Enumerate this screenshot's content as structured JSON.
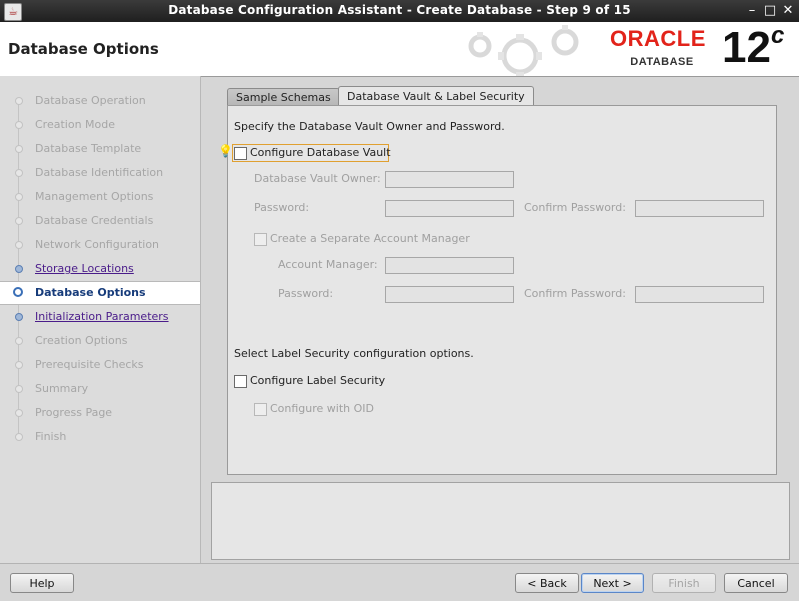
{
  "window": {
    "title": "Database Configuration Assistant - Create Database - Step 9 of 15",
    "controls": {
      "minimize": "–",
      "maximize": "□",
      "close": "✕"
    }
  },
  "header": {
    "page_title": "Database Options",
    "brand": {
      "wordmark": "ORACLE",
      "product": "DATABASE",
      "version": "12",
      "version_suffix": "c"
    }
  },
  "nav": {
    "items": [
      {
        "label": "Database Operation",
        "state": "disabled"
      },
      {
        "label": "Creation Mode",
        "state": "disabled"
      },
      {
        "label": "Database Template",
        "state": "disabled"
      },
      {
        "label": "Database Identification",
        "state": "disabled"
      },
      {
        "label": "Management Options",
        "state": "disabled"
      },
      {
        "label": "Database Credentials",
        "state": "disabled"
      },
      {
        "label": "Network Configuration",
        "state": "disabled"
      },
      {
        "label": "Storage Locations",
        "state": "link"
      },
      {
        "label": "Database Options",
        "state": "current"
      },
      {
        "label": "Initialization Parameters",
        "state": "link"
      },
      {
        "label": "Creation Options",
        "state": "disabled"
      },
      {
        "label": "Prerequisite Checks",
        "state": "disabled"
      },
      {
        "label": "Summary",
        "state": "disabled"
      },
      {
        "label": "Progress Page",
        "state": "disabled"
      },
      {
        "label": "Finish",
        "state": "disabled"
      }
    ]
  },
  "tabs": {
    "sample_schemas": "Sample Schemas",
    "vault_label_security": "Database Vault & Label Security",
    "active": "vault_label_security"
  },
  "vault": {
    "intro": "Specify the Database Vault Owner and Password.",
    "configure_label": "Configure Database Vault",
    "configure_checked": false,
    "owner_label": "Database Vault Owner:",
    "owner_value": "",
    "password_label": "Password:",
    "password_value": "",
    "confirm_password_label": "Confirm Password:",
    "confirm_password_value": "",
    "separate_account_label": "Create a Separate Account Manager",
    "separate_account_checked": false,
    "account_manager_label": "Account Manager:",
    "account_manager_value": "",
    "am_password_label": "Password:",
    "am_password_value": "",
    "am_confirm_password_label": "Confirm Password:",
    "am_confirm_password_value": ""
  },
  "label_security": {
    "intro": "Select Label Security configuration options.",
    "configure_label": "Configure Label Security",
    "configure_checked": false,
    "oid_label": "Configure with OID",
    "oid_checked": false
  },
  "buttons": {
    "help": "Help",
    "back": "< Back",
    "next": "Next >",
    "finish": "Finish",
    "cancel": "Cancel"
  }
}
